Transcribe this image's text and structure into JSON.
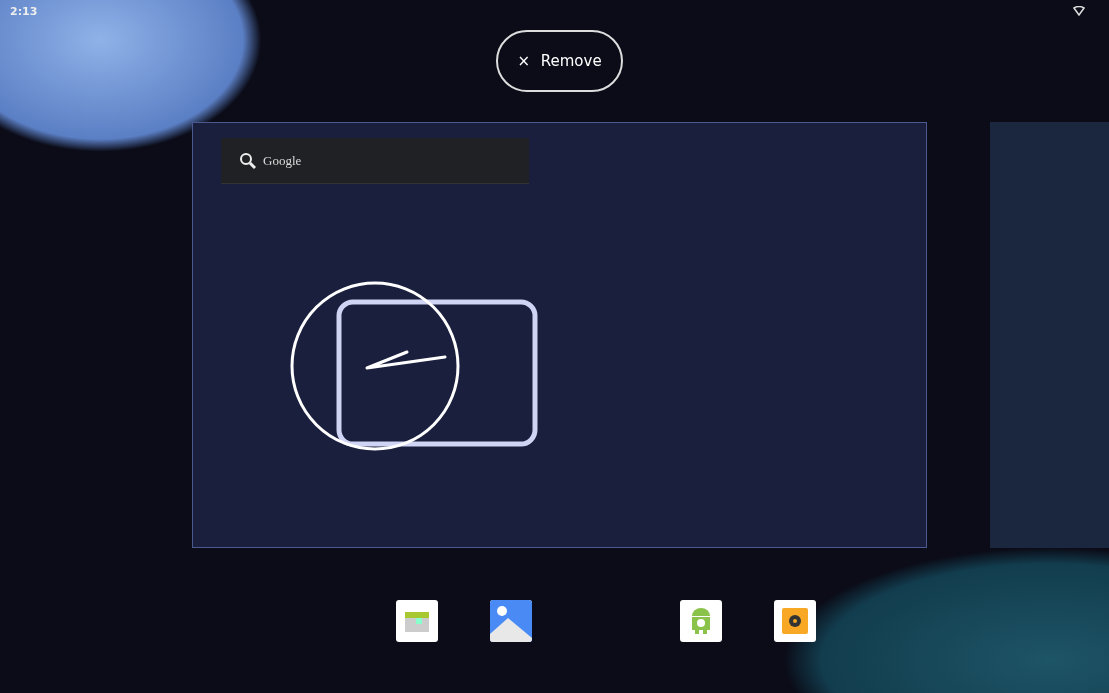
{
  "status_bar": {
    "time": "2:13"
  },
  "remove_button": {
    "icon": "×",
    "label": "Remove"
  },
  "search_widget": {
    "label": "Google"
  },
  "dock": [
    {
      "kind": "spreadsheet"
    },
    {
      "kind": "photos"
    },
    {
      "kind": "android"
    },
    {
      "kind": "camera"
    }
  ]
}
